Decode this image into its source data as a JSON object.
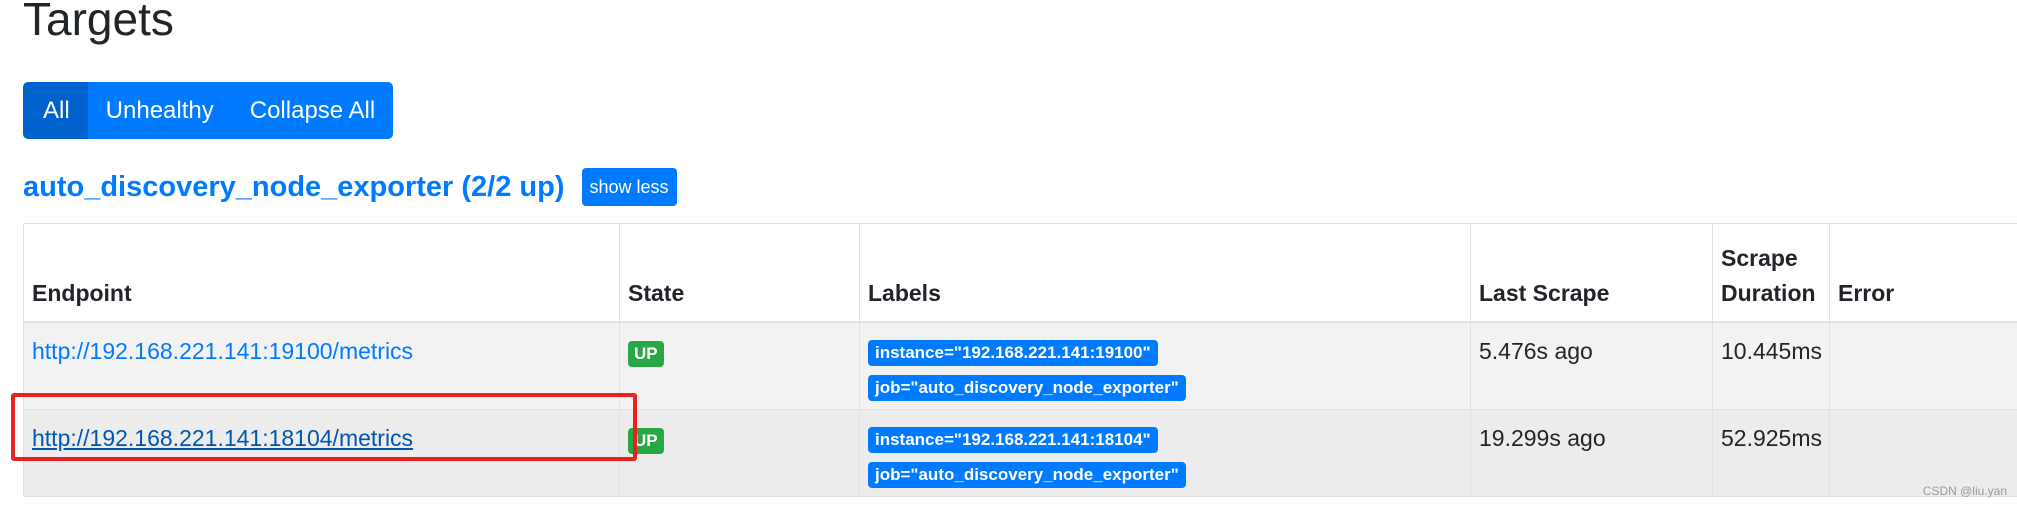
{
  "page": {
    "title": "Targets"
  },
  "filters": {
    "all_label": "All",
    "unhealthy_label": "Unhealthy",
    "collapse_label": "Collapse All"
  },
  "job": {
    "title": "auto_discovery_node_exporter (2/2 up)",
    "toggle_label": "show less"
  },
  "table": {
    "headers": {
      "endpoint": "Endpoint",
      "state": "State",
      "labels": "Labels",
      "last_scrape": "Last Scrape",
      "scrape_duration": "Scrape Duration",
      "error": "Error"
    },
    "rows": [
      {
        "endpoint": "http://192.168.221.141:19100/metrics",
        "state": "UP",
        "labels": [
          "instance=\"192.168.221.141:19100\"",
          "job=\"auto_discovery_node_exporter\""
        ],
        "last_scrape": "5.476s ago",
        "scrape_duration": "10.445ms",
        "error": ""
      },
      {
        "endpoint": "http://192.168.221.141:18104/metrics",
        "state": "UP",
        "labels": [
          "instance=\"192.168.221.141:18104\"",
          "job=\"auto_discovery_node_exporter\""
        ],
        "last_scrape": "19.299s ago",
        "scrape_duration": "52.925ms",
        "error": ""
      }
    ]
  },
  "watermark": "CSDN @liu.yan",
  "colors": {
    "primary": "#007bff",
    "primary_active": "#0062cc",
    "success": "#28a745",
    "annotation_red": "#e8231f"
  }
}
